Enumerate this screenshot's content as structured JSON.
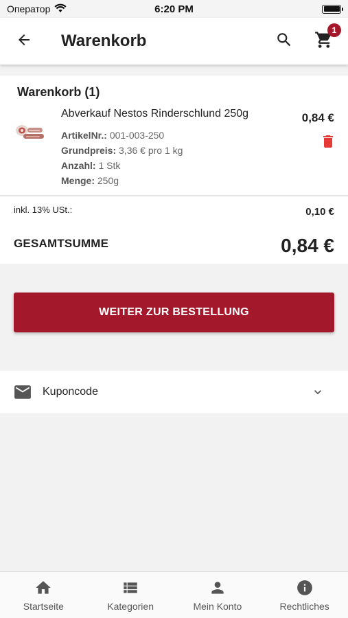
{
  "status_bar": {
    "carrier": "Оператор",
    "time": "6:20 PM"
  },
  "app_bar": {
    "title": "Warenkorb",
    "cart_count": "1",
    "back_icon": "arrow-left-icon",
    "search_icon": "search-icon",
    "cart_icon": "cart-icon"
  },
  "cart": {
    "heading": "Warenkorb (1)",
    "item": {
      "name": "Abverkauf Nestos Rinderschlund 250g",
      "price": "0,84 €",
      "article_label": "ArtikelNr.:",
      "article_value": "001-003-250",
      "base_price_label": "Grundpreis:",
      "base_price_value": "3,36 € pro 1 kg",
      "quantity_label": "Anzahl:",
      "quantity_value": "1 Stk",
      "amount_label": "Menge:",
      "amount_value": "250g"
    }
  },
  "totals": {
    "vat_label": "inkl. 13% USt.:",
    "vat_value": "0,10 €",
    "sum_label": "GESAMTSUMME",
    "sum_value": "0,84 €"
  },
  "order_button": {
    "label": "WEITER ZUR BESTELLUNG"
  },
  "coupon": {
    "label": "Kuponcode",
    "icon": "mail-icon"
  },
  "bottom_nav": {
    "items": [
      {
        "label": "Startseite",
        "icon": "home-icon"
      },
      {
        "label": "Kategorien",
        "icon": "list-icon"
      },
      {
        "label": "Mein Konto",
        "icon": "person-icon"
      },
      {
        "label": "Rechtliches",
        "icon": "info-icon"
      }
    ]
  },
  "colors": {
    "accent": "#a4182b",
    "delete": "#e53935",
    "background": "#f2f2f2"
  }
}
